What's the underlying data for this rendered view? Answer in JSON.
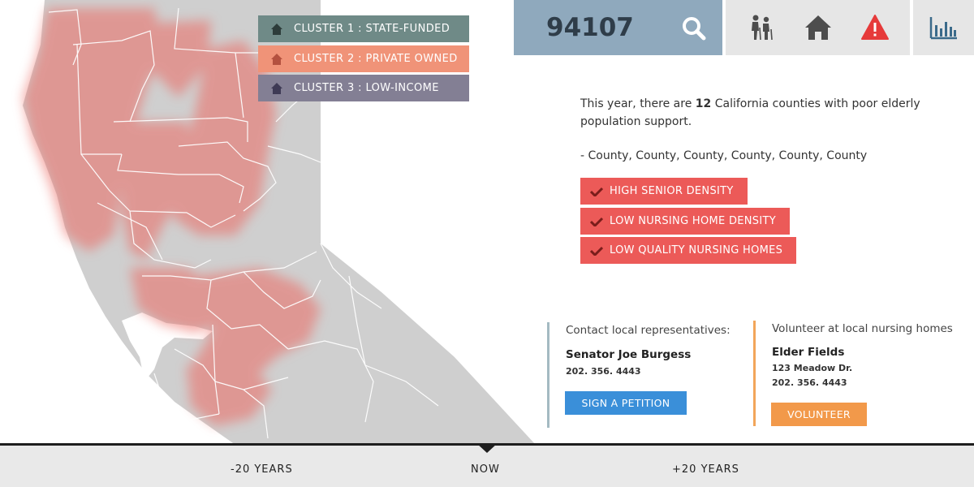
{
  "search": {
    "zip": "94107"
  },
  "legend": [
    {
      "label": "CLUSTER 1 : STATE-FUNDED",
      "color": "#6f8a87"
    },
    {
      "label": "CLUSTER 2 : PRIVATE OWNED",
      "color": "#f09378"
    },
    {
      "label": "CLUSTER 3 : LOW-INCOME",
      "color": "#837f94"
    }
  ],
  "toolbar": {
    "icons": [
      "search-icon",
      "elderly-couple-icon",
      "home-icon",
      "warning-icon",
      "bar-chart-icon"
    ]
  },
  "info": {
    "lead_before": "This year, there are ",
    "count": "12",
    "lead_after": " California counties with poor elderly population support.",
    "counties": "- County, County, County, County, County, County"
  },
  "criteria": [
    "HIGH SENIOR DENSITY",
    "LOW NURSING HOME DENSITY",
    "LOW QUALITY NURSING HOMES"
  ],
  "representatives": {
    "heading": "Contact local representatives:",
    "name": "Senator Joe Burgess",
    "phone": "202. 356. 4443",
    "button": "SIGN A PETITION"
  },
  "volunteer": {
    "heading": "Volunteer at local nursing homes",
    "name": "Elder Fields",
    "address": "123 Meadow Dr.",
    "phone": "202. 356. 4443",
    "button": "VOLUNTEER"
  },
  "timeline": {
    "past": "-20 YEARS",
    "now": "NOW",
    "future": "+20 YEARS"
  },
  "colors": {
    "map_land": "#cfcfcf",
    "map_highlight": "#ec6a64",
    "accent_red": "#ec5a58",
    "search_bg": "#8fa9bd"
  }
}
